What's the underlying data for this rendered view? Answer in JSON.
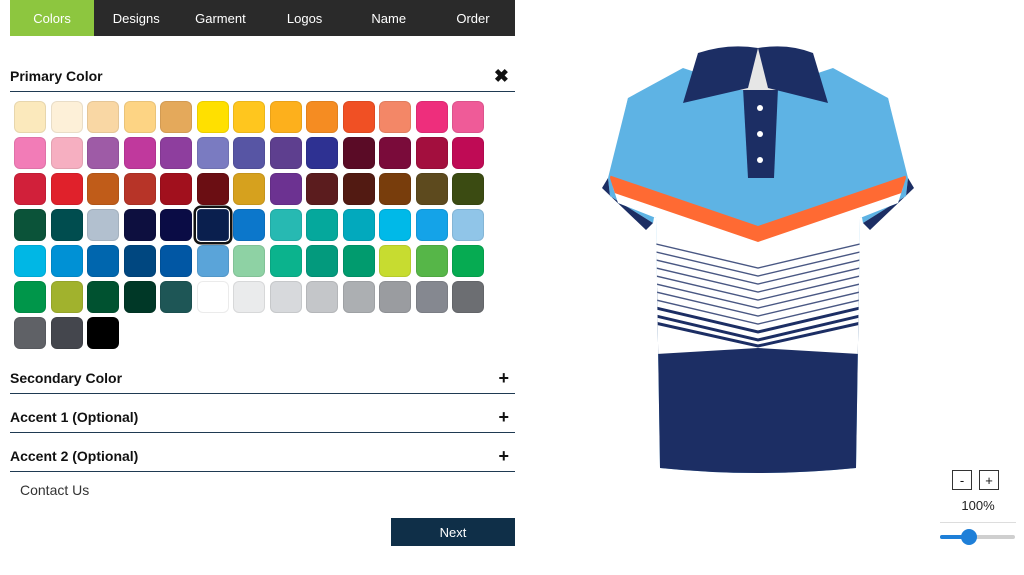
{
  "tabs": [
    "Colors",
    "Designs",
    "Garment",
    "Logos",
    "Name",
    "Order"
  ],
  "active_tab": "Colors",
  "sections": {
    "primary": {
      "title": "Primary Color",
      "toggle": "✖"
    },
    "secondary": {
      "title": "Secondary Color",
      "toggle": "+"
    },
    "accent1": {
      "title": "Accent 1 (Optional)",
      "toggle": "+"
    },
    "accent2": {
      "title": "Accent 2 (Optional)",
      "toggle": "+"
    }
  },
  "swatch_colors": [
    "#fbe9bc",
    "#fdf0d8",
    "#f9d7a4",
    "#fdd484",
    "#e4a95b",
    "#ffe000",
    "#ffc61e",
    "#fdb01c",
    "#f58c22",
    "#f05024",
    "#f38767",
    "#ee2e7c",
    "#ef5b98",
    "#f27cb7",
    "#f6afc1",
    "#9e5ba6",
    "#c0399d",
    "#8e3e9e",
    "#7a7bc1",
    "#5755a4",
    "#5e3f8f",
    "#2e3192",
    "#5a0b26",
    "#7a0b3a",
    "#a30f3e",
    "#bf0b55",
    "#d1203a",
    "#e0212b",
    "#c05c19",
    "#b73428",
    "#a1101d",
    "#6b0e13",
    "#d6a11e",
    "#6c3291",
    "#5b1c1e",
    "#521a12",
    "#783d0c",
    "#5d4a1e",
    "#3b4b12",
    "#0b5339",
    "#004d4f",
    "#b2c0cf",
    "#0d0f3f",
    "#0a0c45",
    "#0a1f4e",
    "#0c77cb",
    "#27b9b2",
    "#05a89c",
    "#02a9bd",
    "#00b9e8",
    "#14a3e8",
    "#90c5e8",
    "#00b7e5",
    "#0091d5",
    "#0066ae",
    "#004780",
    "#0157a4",
    "#5aa4d9",
    "#8ed2a4",
    "#0bb38d",
    "#039a7d",
    "#019b6e",
    "#c7dc30",
    "#56b648",
    "#06ab52",
    "#00964a",
    "#a1b22d",
    "#005230",
    "#003827",
    "#1e5656",
    "#ffffff",
    "#eaebec",
    "#d7d9dc",
    "#c4c6c9",
    "#acafb2",
    "#9a9ca0",
    "#858890",
    "#6c6e72",
    "#5f6166",
    "#44464d",
    "#000000"
  ],
  "selected_swatch": 44,
  "contact_label": "Contact Us",
  "next_label": "Next",
  "zoom": {
    "minus": "-",
    "plus": "+",
    "level": "100%",
    "slider_fraction": 0.38
  },
  "shirt_colors": {
    "body": "#5eb3e4",
    "navy": "#1c2e64",
    "stripe": "#ff6a33"
  }
}
